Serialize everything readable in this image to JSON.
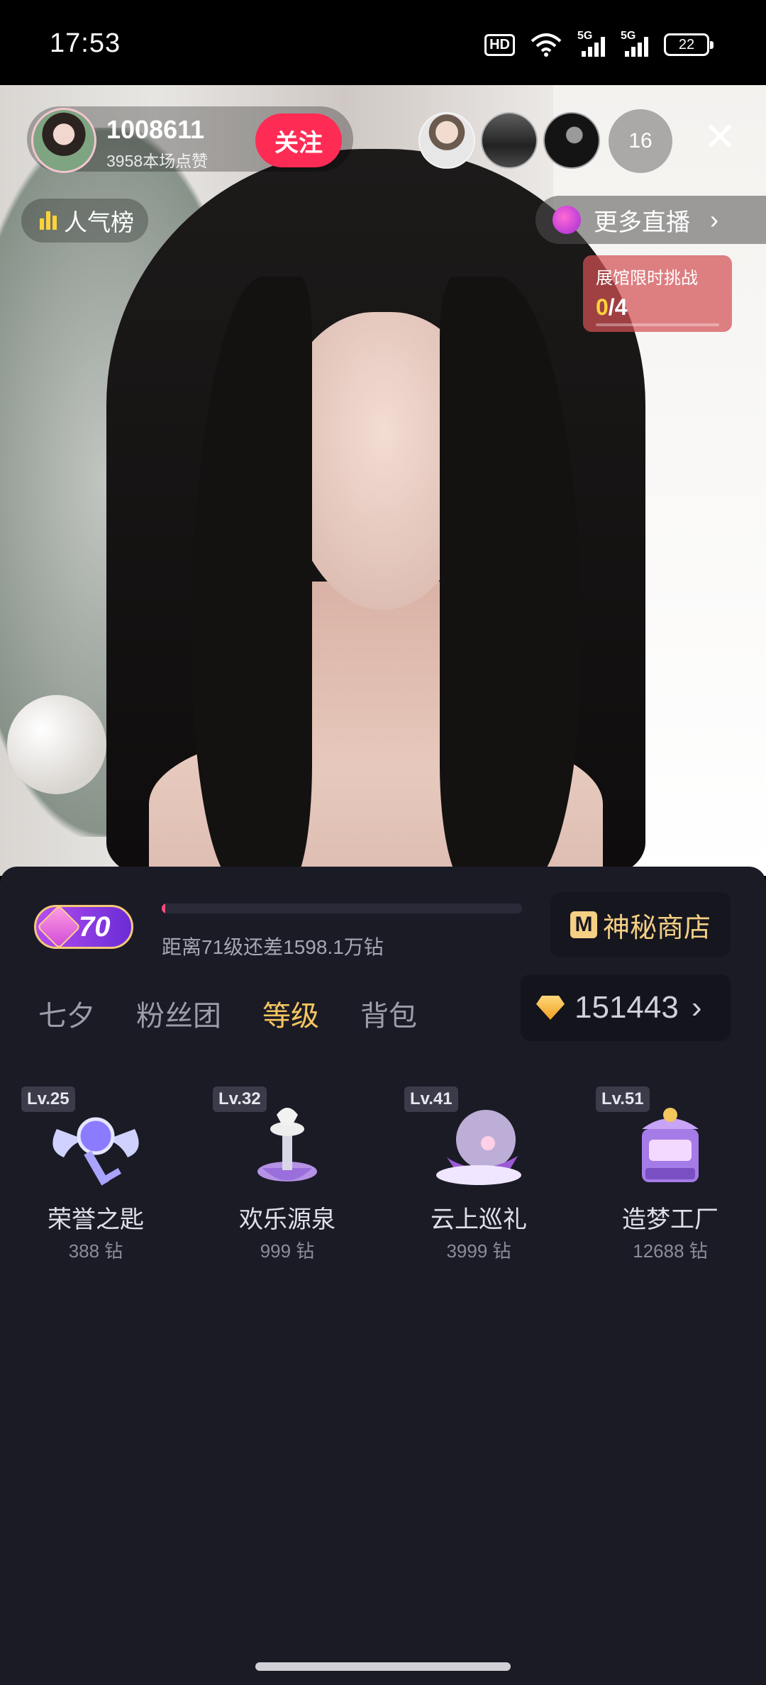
{
  "status_bar": {
    "time": "17:53",
    "hd_label": "HD",
    "net1": "5G",
    "net2": "5G",
    "battery": "22"
  },
  "anchor": {
    "name": "1008611",
    "likes": "3958本场点赞",
    "follow_label": "关注"
  },
  "viewers": {
    "count": "16"
  },
  "rank": {
    "label": "人气榜"
  },
  "more_live": {
    "label": "更多直播"
  },
  "challenge": {
    "title": "展馆限时挑战",
    "current": "0",
    "total": "/4"
  },
  "level": {
    "value": "70",
    "progress_text": "距离71级还差1598.1万钻",
    "progress_fraction": 0.01
  },
  "shop": {
    "icon": "M",
    "label": "神秘商店"
  },
  "tabs": [
    {
      "label": "七夕",
      "active": false
    },
    {
      "label": "粉丝团",
      "active": false
    },
    {
      "label": "等级",
      "active": true
    },
    {
      "label": "背包",
      "active": false
    }
  ],
  "balance": {
    "value": "151443"
  },
  "gifts": [
    {
      "level": "Lv.25",
      "name": "荣誉之匙",
      "price": "388 钻",
      "icon": "winged-key-icon"
    },
    {
      "level": "Lv.32",
      "name": "欢乐源泉",
      "price": "999 钻",
      "icon": "fountain-icon"
    },
    {
      "level": "Lv.41",
      "name": "云上巡礼",
      "price": "3999 钻",
      "icon": "cloud-ship-icon"
    },
    {
      "level": "Lv.51",
      "name": "造梦工厂",
      "price": "12688 钻",
      "icon": "dream-factory-icon"
    }
  ],
  "colors": {
    "follow": "#fe2c55",
    "accent_gold": "#f4c65e",
    "panel_bg": "#1b1b26"
  }
}
